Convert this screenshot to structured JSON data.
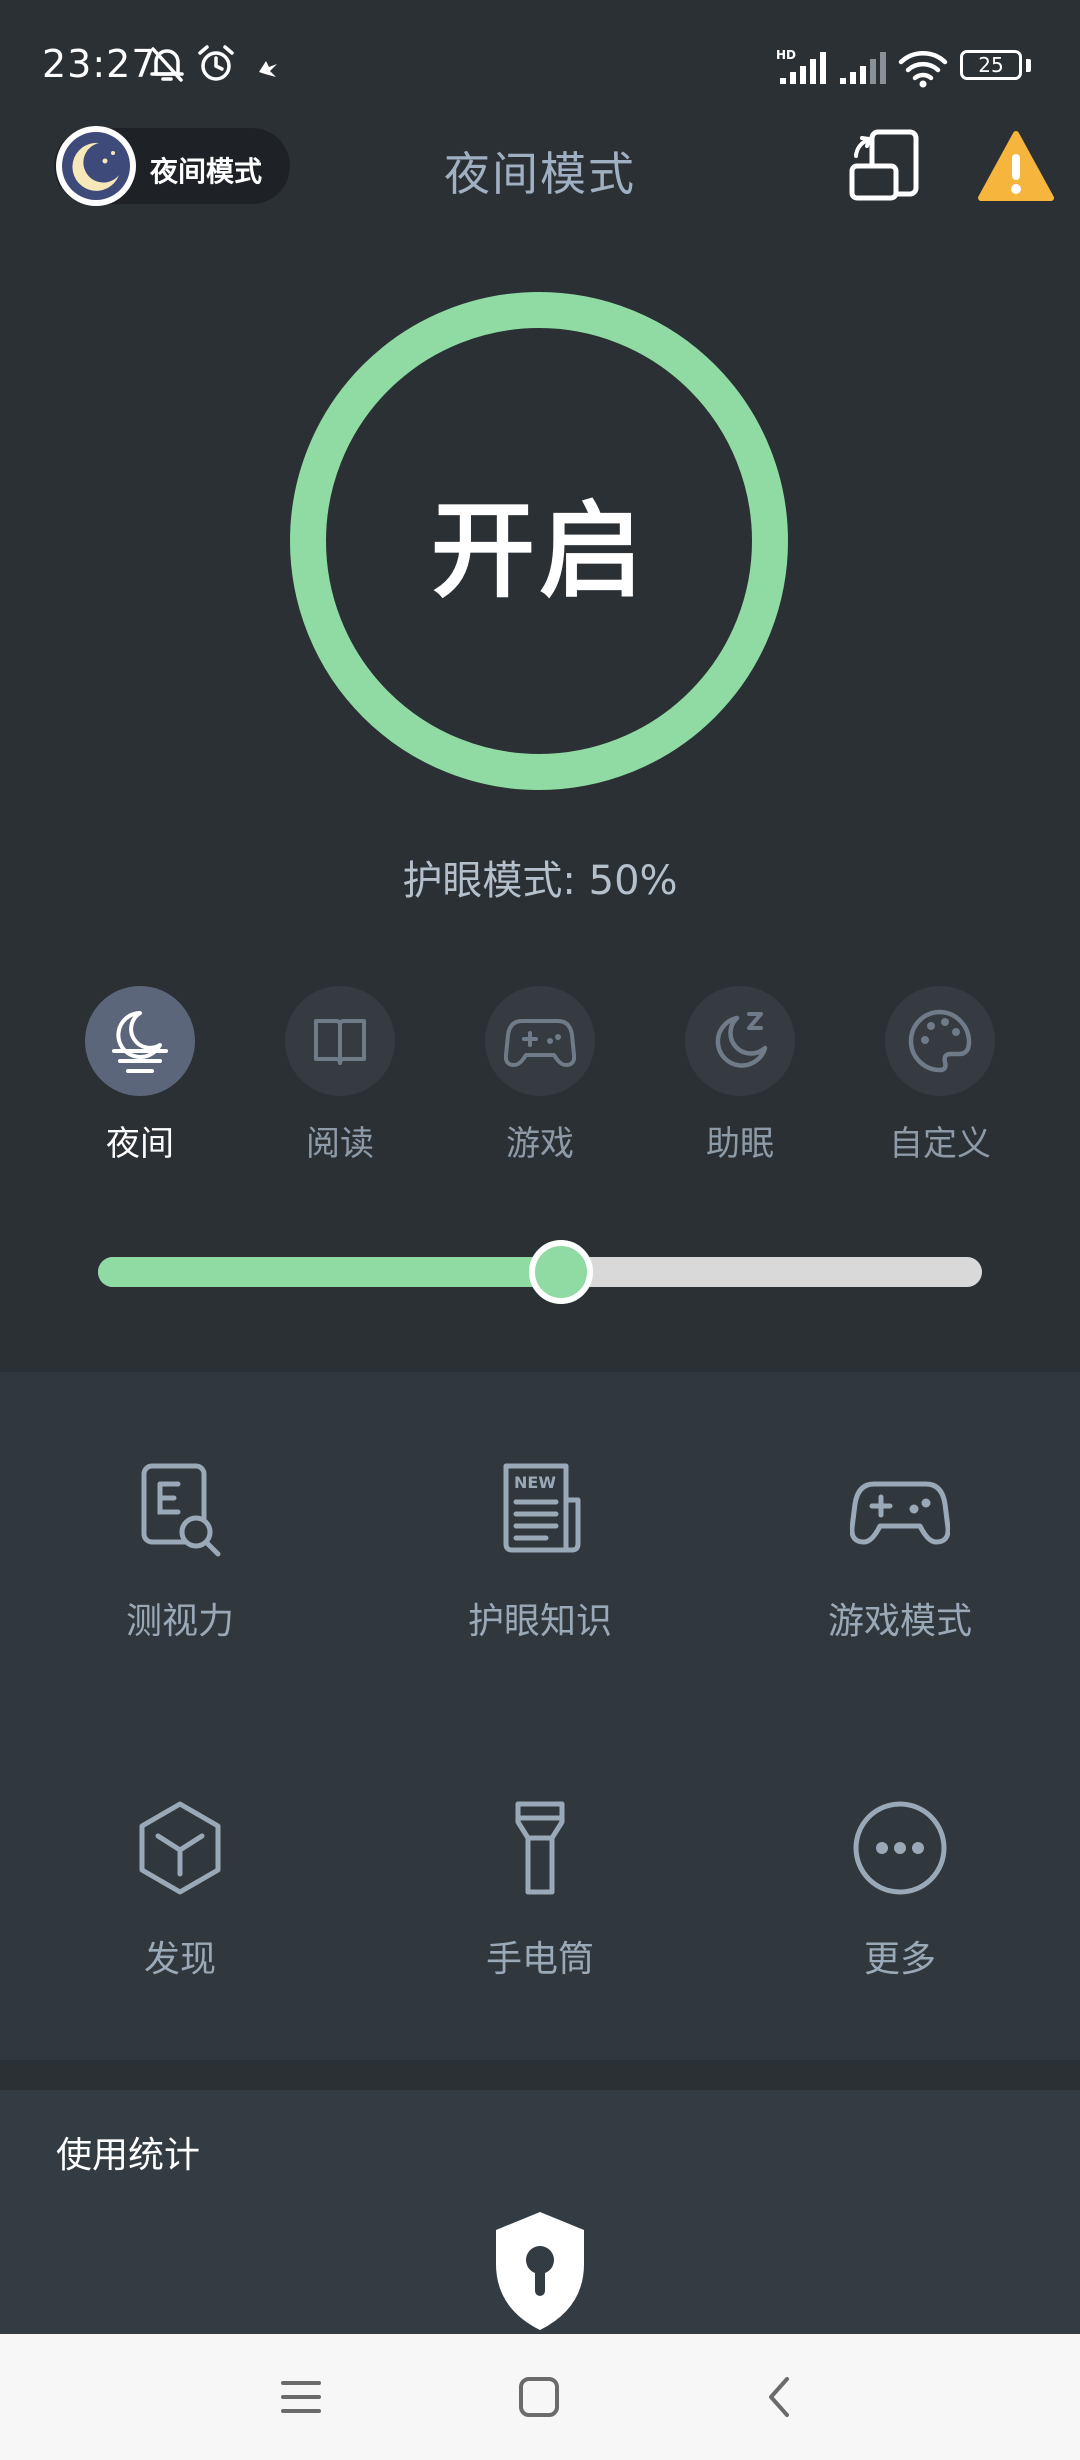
{
  "status_bar": {
    "time": "23:27",
    "battery": "25",
    "network_label": "HD",
    "icons": [
      "mute-bell-icon",
      "alarm-icon",
      "app-notification-icon",
      "signal-hd-icon",
      "signal-icon",
      "wifi-icon",
      "battery-icon"
    ]
  },
  "header": {
    "chip_label": "夜间模式",
    "title": "夜间模式",
    "icons": [
      "rotate-phone-icon",
      "warning-icon"
    ]
  },
  "power": {
    "label": "开启",
    "ring_color": "#8fdba3"
  },
  "eye_mode": {
    "text": "护眼模式: 50%",
    "level": 0.5
  },
  "modes": [
    {
      "label": "夜间",
      "icon": "night-moon-icon",
      "active": true
    },
    {
      "label": "阅读",
      "icon": "book-icon",
      "active": false
    },
    {
      "label": "游戏",
      "icon": "gamepad-icon",
      "active": false
    },
    {
      "label": "助眠",
      "icon": "sleep-moon-icon",
      "active": false
    },
    {
      "label": "自定义",
      "icon": "palette-icon",
      "active": false
    }
  ],
  "slider": {
    "value": 0.524,
    "fill_color": "#8fdba3",
    "track_color": "#d9d9d9"
  },
  "tools": [
    {
      "label": "测视力",
      "icon": "eye-test-icon"
    },
    {
      "label": "护眼知识",
      "icon": "news-icon",
      "icon_text": "NEW"
    },
    {
      "label": "游戏模式",
      "icon": "gamepad-icon"
    },
    {
      "label": "发现",
      "icon": "cube-icon"
    },
    {
      "label": "手电筒",
      "icon": "flashlight-icon"
    },
    {
      "label": "更多",
      "icon": "more-icon"
    }
  ],
  "stats": {
    "title": "使用统计",
    "icon": "shield-lock-icon"
  },
  "nav": {
    "icons": [
      "menu-icon",
      "home-icon",
      "back-icon"
    ]
  },
  "colors": {
    "background": "#2b3034",
    "panel": "#30383e",
    "accent_green": "#8fdba3",
    "warning": "#f6b53c",
    "muted_text": "#9aa9b8"
  }
}
